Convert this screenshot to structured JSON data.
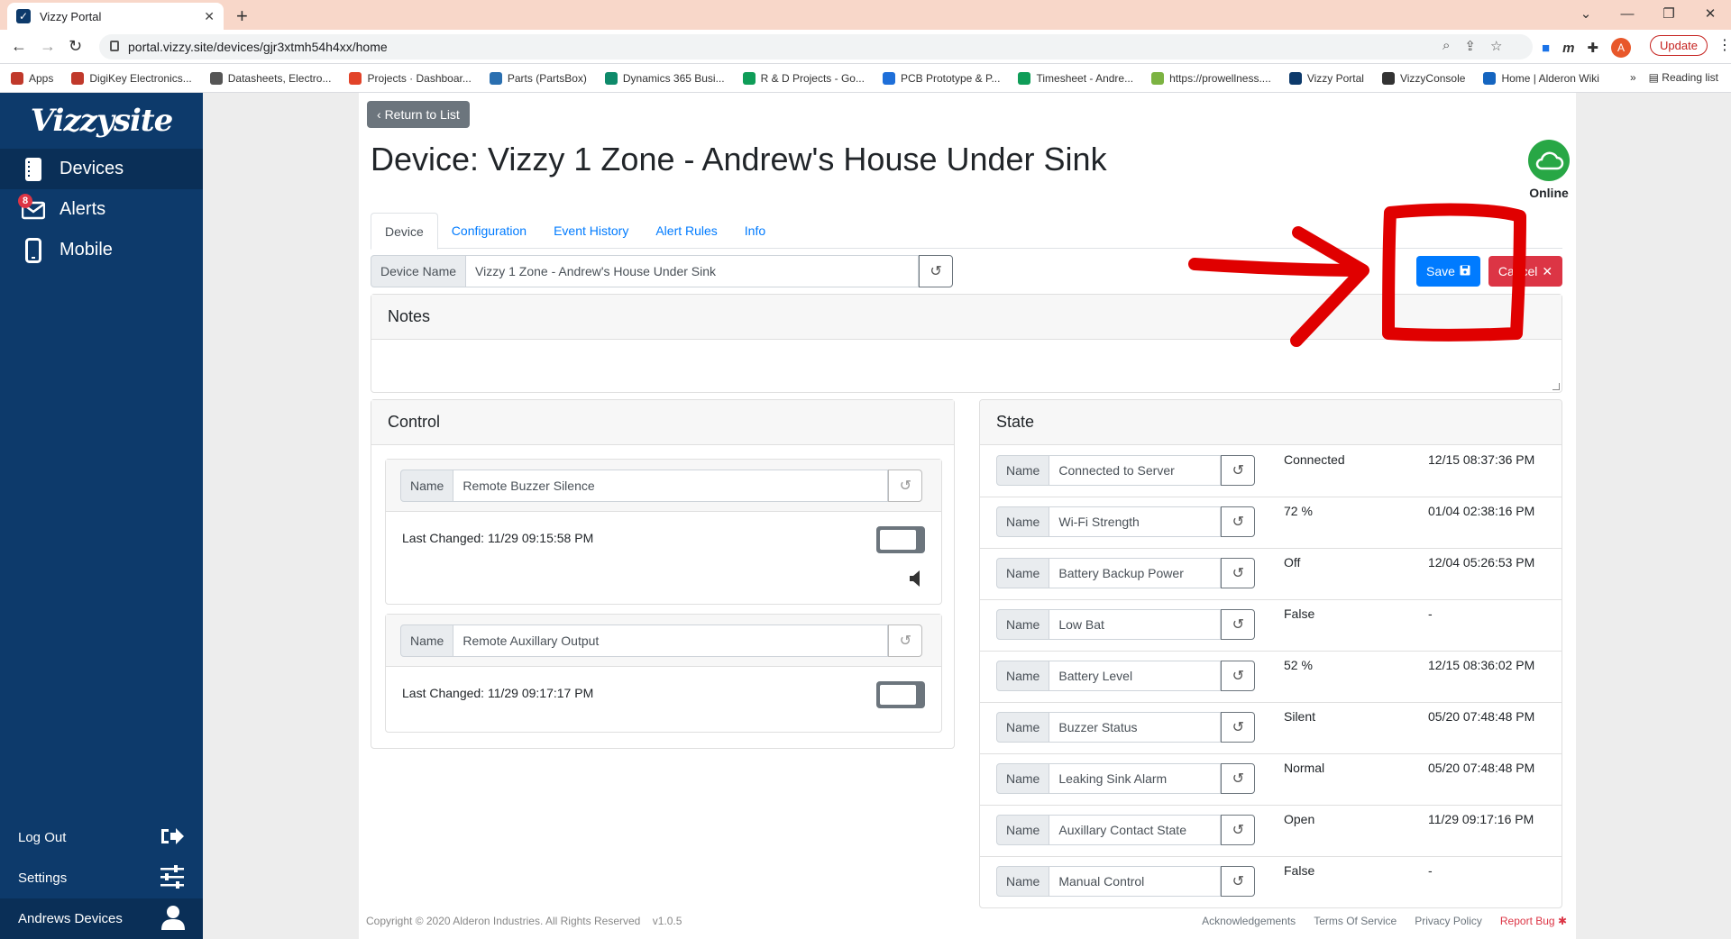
{
  "browser": {
    "tab_title": "Vizzy Portal",
    "url": "portal.vizzy.site/devices/gjr3xtmh54h4xx/home",
    "update_label": "Update",
    "profile_initial": "A",
    "bookmarks": [
      {
        "label": "Apps",
        "color": "#c0392b"
      },
      {
        "label": "DigiKey Electronics...",
        "color": "#c0392b"
      },
      {
        "label": "Datasheets, Electro...",
        "color": "#555555"
      },
      {
        "label": "Projects · Dashboar...",
        "color": "#e24329"
      },
      {
        "label": "Parts (PartsBox)",
        "color": "#2a6fb0"
      },
      {
        "label": "Dynamics 365 Busi...",
        "color": "#0e8a6a"
      },
      {
        "label": "R & D Projects - Go...",
        "color": "#0f9d58"
      },
      {
        "label": "PCB Prototype & P...",
        "color": "#1e6fd9"
      },
      {
        "label": "Timesheet - Andre...",
        "color": "#0f9d58"
      },
      {
        "label": "https://prowellness....",
        "color": "#7cb342"
      },
      {
        "label": "Vizzy Portal",
        "color": "#0d3a6b"
      },
      {
        "label": "VizzyConsole",
        "color": "#333333"
      },
      {
        "label": "Home | Alderon Wiki",
        "color": "#1565c0"
      }
    ],
    "reading_list": "Reading list"
  },
  "sidebar": {
    "logo": "Vizzysite",
    "items": [
      {
        "label": "Devices",
        "icon": "devices-icon",
        "active": true
      },
      {
        "label": "Alerts",
        "icon": "alerts-icon",
        "badge": "8"
      },
      {
        "label": "Mobile",
        "icon": "mobile-icon"
      }
    ],
    "bottom": {
      "logout": "Log Out",
      "settings": "Settings",
      "user": "Andrews Devices"
    }
  },
  "main": {
    "back_label": "Return to List",
    "title": "Device: Vizzy 1 Zone - Andrew's House Under Sink",
    "status": "Online",
    "tabs": [
      "Device",
      "Configuration",
      "Event History",
      "Alert Rules",
      "Info"
    ],
    "device_name_label": "Device Name",
    "device_name_value": "Vizzy 1 Zone - Andrew's House Under Sink",
    "save_label": "Save",
    "cancel_label": "Cancel",
    "notes_title": "Notes",
    "control": {
      "title": "Control",
      "name_label": "Name",
      "items": [
        {
          "name": "Remote Buzzer Silence",
          "last_changed": "Last Changed: 11/29 09:15:58 PM"
        },
        {
          "name": "Remote Auxillary Output",
          "last_changed": "Last Changed: 11/29 09:17:17 PM"
        }
      ]
    },
    "state": {
      "title": "State",
      "name_label": "Name",
      "rows": [
        {
          "name": "Connected to Server",
          "value": "Connected",
          "time": "12/15 08:37:36 PM"
        },
        {
          "name": "Wi-Fi Strength",
          "value": "72 %",
          "time": "01/04 02:38:16 PM"
        },
        {
          "name": "Battery Backup Power",
          "value": "Off",
          "time": "12/04 05:26:53 PM"
        },
        {
          "name": "Low Bat",
          "value": "False",
          "time": "-"
        },
        {
          "name": "Battery Level",
          "value": "52 %",
          "time": "12/15 08:36:02 PM"
        },
        {
          "name": "Buzzer Status",
          "value": "Silent",
          "time": "05/20 07:48:48 PM"
        },
        {
          "name": "Leaking Sink Alarm",
          "value": "Normal",
          "time": "05/20 07:48:48 PM"
        },
        {
          "name": "Auxillary Contact State",
          "value": "Open",
          "time": "11/29 09:17:16 PM"
        },
        {
          "name": "Manual Control",
          "value": "False",
          "time": "-"
        }
      ]
    }
  },
  "footer": {
    "copyright": "Copyright © 2020 Alderon Industries. All Rights Reserved",
    "version": "v1.0.5",
    "links": [
      "Acknowledgements",
      "Terms Of Service",
      "Privacy Policy",
      "Report Bug"
    ]
  },
  "colors": {
    "sidebar": "#0d3a6b",
    "primary": "#007bff",
    "danger": "#dc3545",
    "online": "#28a745",
    "annotation": "#e00000"
  }
}
